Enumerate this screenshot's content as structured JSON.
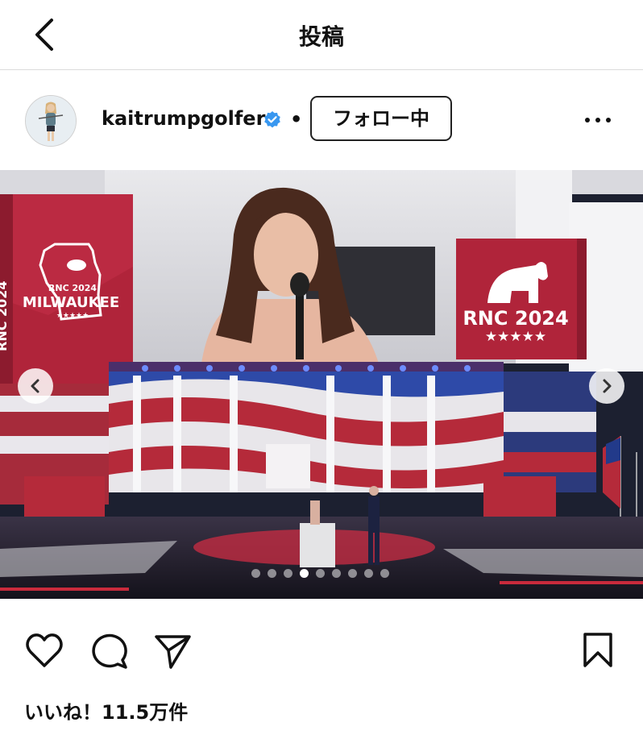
{
  "topbar": {
    "title": "投稿"
  },
  "post": {
    "username": "kaitrumpgolfer",
    "separator": "•",
    "follow_label": "フォロー中",
    "carousel": {
      "total": 9,
      "active_index": 3
    },
    "photo_signs": {
      "left_sign_vertical": "RNC 2024",
      "left_sign_year": "RNC 2024",
      "left_sign_city": "MILWAUKEE",
      "left_sign_stars": "★★★★★",
      "right_sign_title": "RNC 2024",
      "right_sign_stars": "★★★★★"
    },
    "likes_text": "いいね！11.5万件"
  },
  "colors": {
    "verified": "#3897f0",
    "sign_red": "#b0243a"
  },
  "icons": [
    "back-chevron-icon",
    "verified-badge-icon",
    "more-options-icon",
    "carousel-prev-icon",
    "carousel-next-icon",
    "heart-icon",
    "comment-icon",
    "share-icon",
    "bookmark-icon"
  ]
}
